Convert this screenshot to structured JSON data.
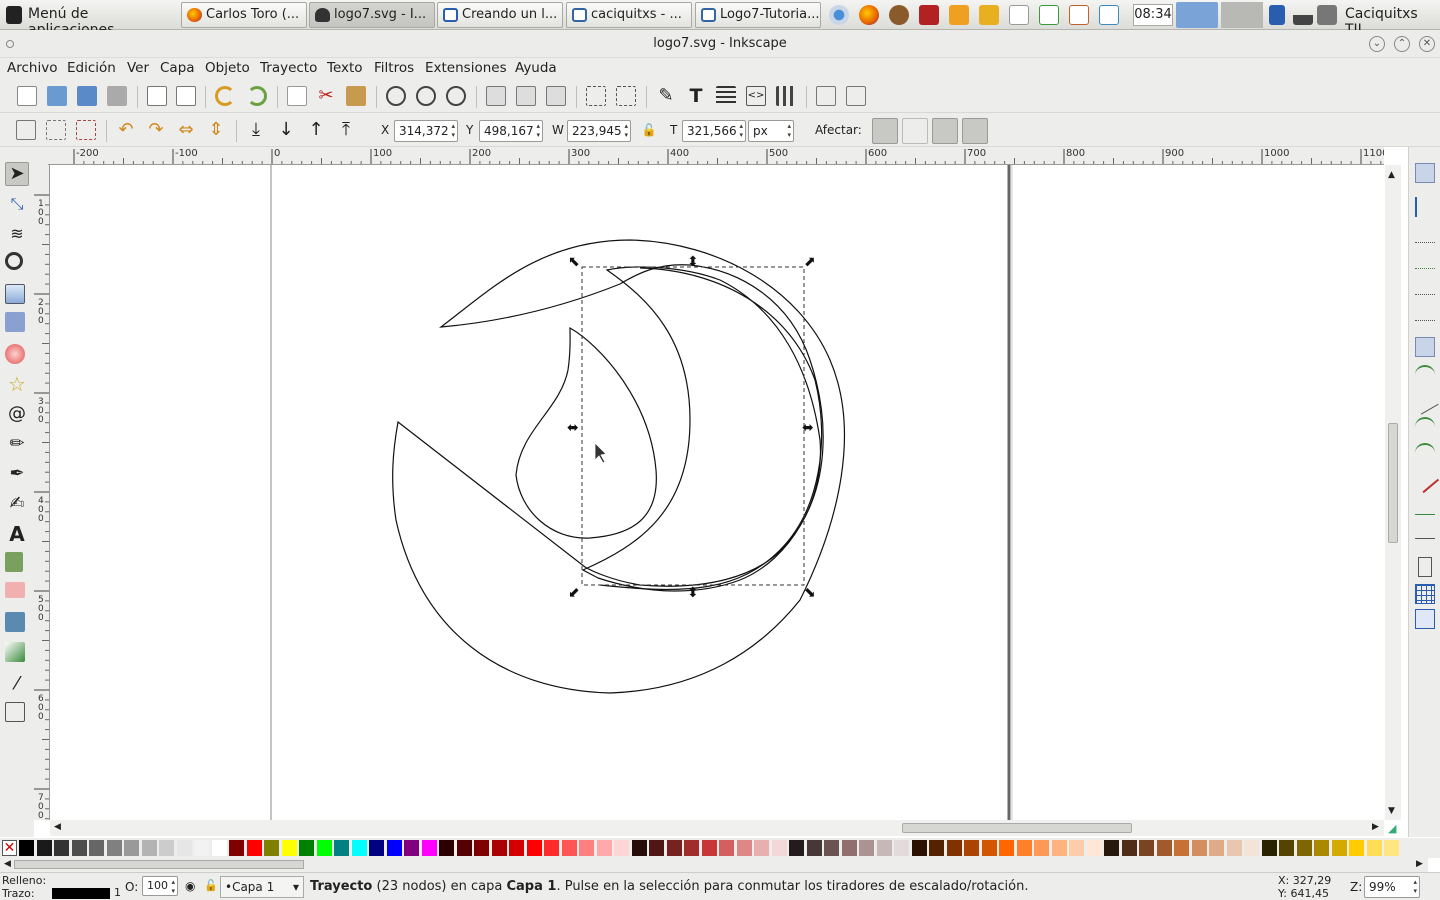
{
  "taskbar": {
    "menu_label": "Menú de aplicaciones",
    "tasks": [
      {
        "label": "Carlos Toro (...",
        "icon": "firefox-icon",
        "color": "#e66000"
      },
      {
        "label": "logo7.svg - I...",
        "icon": "inkscape-icon",
        "color": "#333333"
      },
      {
        "label": "Creando un l...",
        "icon": "document-icon",
        "color": "#2a5db0"
      },
      {
        "label": "caciquitxs - ...",
        "icon": "folder-icon",
        "color": "#3465a4"
      },
      {
        "label": "Logo7-Tutoria...",
        "icon": "folder-icon",
        "color": "#3465a4"
      }
    ],
    "clock": "08:34",
    "user": "Caciquitxs TIL"
  },
  "window": {
    "title": "logo7.svg - Inkscape"
  },
  "menu": [
    "Archivo",
    "Edición",
    "Ver",
    "Capa",
    "Objeto",
    "Trayecto",
    "Texto",
    "Filtros",
    "Extensiones",
    "Ayuda"
  ],
  "controls": {
    "x_label": "X",
    "x_value": "314,372",
    "y_label": "Y",
    "y_value": "498,167",
    "w_label": "W",
    "w_value": "223,945",
    "h_label": "T",
    "h_value": "321,566",
    "unit": "px",
    "affect_label": "Afectar:"
  },
  "ruler": {
    "h_labels": [
      "-200",
      "-100",
      "0",
      "100",
      "200",
      "300",
      "400",
      "500",
      "600",
      "700",
      "800",
      "900",
      "1000",
      "1100"
    ],
    "v_labels": [
      "100",
      "200",
      "300",
      "400",
      "500",
      "600",
      "700"
    ]
  },
  "palette": [
    "#000000",
    "#1a1a1a",
    "#333333",
    "#4d4d4d",
    "#666666",
    "#808080",
    "#999999",
    "#b3b3b3",
    "#cccccc",
    "#e6e6e6",
    "#f2f2f2",
    "#ffffff",
    "#800000",
    "#ff0000",
    "#808000",
    "#ffff00",
    "#008000",
    "#00ff00",
    "#008080",
    "#00ffff",
    "#000080",
    "#0000ff",
    "#800080",
    "#ff00ff",
    "#2b0000",
    "#550000",
    "#800000",
    "#aa0000",
    "#d40000",
    "#ff0000",
    "#ff2a2a",
    "#ff5555",
    "#ff8080",
    "#ffaaaa",
    "#ffd5d5",
    "#280b0b",
    "#501616",
    "#782121",
    "#a02c2c",
    "#c83737",
    "#d35f5f",
    "#de8787",
    "#e9afaf",
    "#f4d7d7",
    "#241c1c",
    "#483737",
    "#6c5353",
    "#916f6f",
    "#ac9393",
    "#c8b7b7",
    "#e3dbdb",
    "#2b1100",
    "#552200",
    "#803300",
    "#aa4400",
    "#d45500",
    "#ff6600",
    "#ff7f2a",
    "#ff9955",
    "#ffb380",
    "#ffccaa",
    "#ffe6d5",
    "#28170b",
    "#502d16",
    "#784421",
    "#a05a2c",
    "#c87137",
    "#d38d5f",
    "#deaa87",
    "#e9c6af",
    "#f4e3d7",
    "#2b2200",
    "#554400",
    "#806600",
    "#aa8800",
    "#d4aa00",
    "#ffcc00",
    "#ffdd55",
    "#ffe680"
  ],
  "status": {
    "fill_label": "Relleno:",
    "stroke_label": "Trazo:",
    "stroke_width": "1",
    "opacity_label": "O:",
    "opacity_value": "100",
    "layer": "•Capa 1",
    "message_bold": "Trayecto",
    "message_1": " (23 nodos) en capa ",
    "message_layer": "Capa 1",
    "message_2": ". Pulse en la selección para conmutar los tiradores de escalado/rotación.",
    "x_coord": "X: 327,29",
    "y_coord": "Y: 641,45",
    "zoom_label": "Z:",
    "zoom_value": "99%"
  }
}
